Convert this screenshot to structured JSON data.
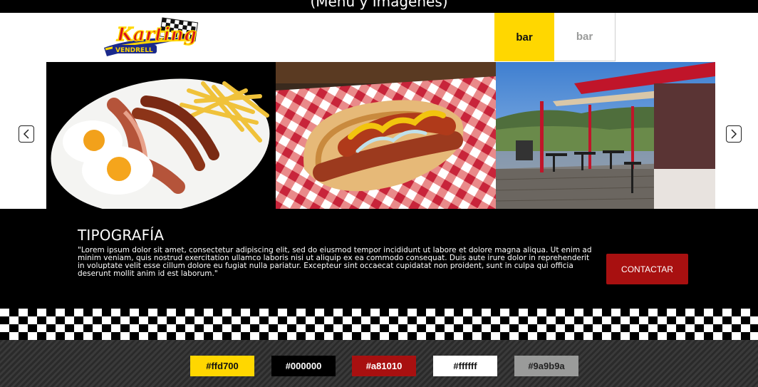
{
  "top_strip": {
    "text": "(Menú y Imágenes)"
  },
  "header": {
    "logo_name": "karting-vendrell-logo",
    "nav": [
      {
        "label": "bar",
        "active": true
      },
      {
        "label": "bar",
        "active": false
      }
    ]
  },
  "carousel": {
    "prev_icon": "chevron-left-icon",
    "next_icon": "chevron-right-icon",
    "slides": [
      "breakfast-plate-photo",
      "hotdog-photo",
      "terrace-photo"
    ]
  },
  "info": {
    "title": "TIPOGRAFÍA",
    "body": "\"Lorem ipsum dolor sit amet, consectetur adipiscing elit, sed do eiusmod tempor incididunt ut labore et dolore magna aliqua. Ut enim ad minim veniam, quis nostrud exercitation ullamco laboris nisi ut aliquip ex ea commodo consequat. Duis aute irure dolor in reprehenderit in voluptate velit esse cillum dolore eu fugiat nulla pariatur. Excepteur sint occaecat cupidatat non proident, sunt in culpa qui officia deserunt mollit anim id est laborum.\"",
    "cta_label": "CONTACTAR"
  },
  "palette": [
    {
      "label": "#ffd700",
      "color": "#ffd700",
      "text_color": "#111111"
    },
    {
      "label": "#000000",
      "color": "#000000",
      "text_color": "#ffffff"
    },
    {
      "label": "#a81010",
      "color": "#a81010",
      "text_color": "#ffffff"
    },
    {
      "label": "#ffffff",
      "color": "#ffffff",
      "text_color": "#111111"
    },
    {
      "label": "#9a9b9a",
      "color": "#9a9b9a",
      "text_color": "#222222"
    }
  ],
  "colors": {
    "accent": "#ffd700",
    "brand_red": "#a81010",
    "grey": "#9a9b9a"
  }
}
